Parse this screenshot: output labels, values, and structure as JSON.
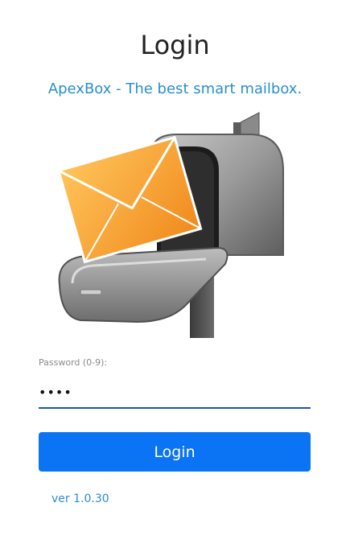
{
  "page": {
    "title": "Login",
    "subtitle": "ApexBox - The best smart mailbox."
  },
  "hero": {
    "icon": "mailbox-with-envelope-icon"
  },
  "form": {
    "password_label": "Password (0-9):",
    "password_value": "1234",
    "login_label": "Login"
  },
  "footer": {
    "version": "ver 1.0.30"
  },
  "colors": {
    "accent_text": "#2a8ecf",
    "button_bg": "#0a74f5",
    "field_underline": "#1a56a8",
    "envelope": "#f5a534",
    "mailbox": "#8c8c8c"
  }
}
